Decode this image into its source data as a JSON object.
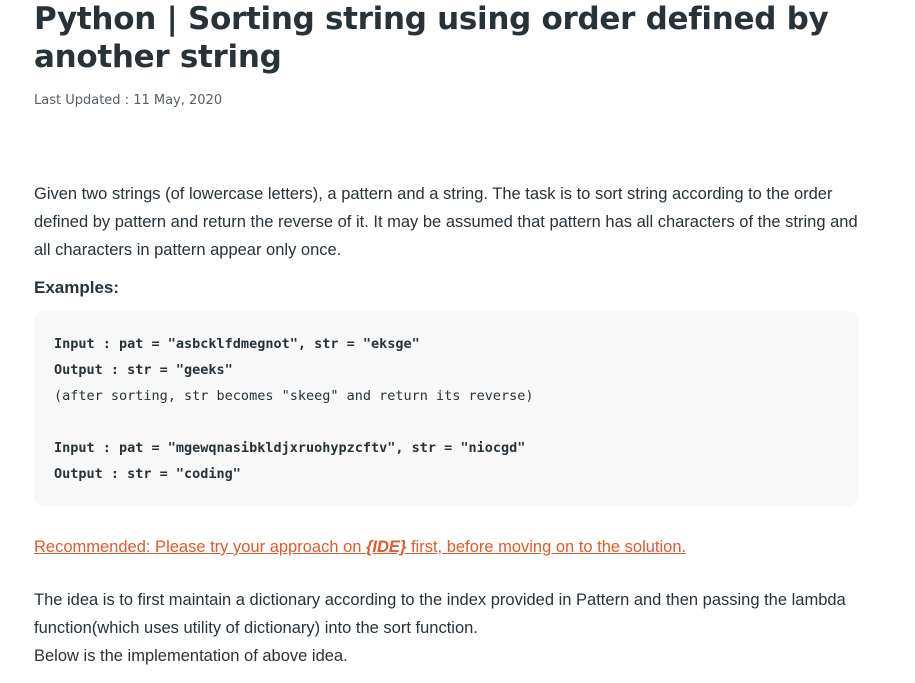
{
  "article": {
    "title": "Python | Sorting string using order defined by another string",
    "last_updated": "Last Updated : 11 May, 2020",
    "intro": "Given two strings (of lowercase letters), a pattern and a string. The task is to sort string according to the order defined by pattern and return the reverse of it. It may be assumed that pattern has all characters of the string and all characters in pattern appear only once.",
    "examples_heading": "Examples:",
    "code_lines": [
      "Input : pat = \"asbcklfdmegnot\", str = \"eksge\"",
      "Output : str = \"geeks\"",
      "(after sorting, str becomes \"skeeg\" and return its reverse)",
      "Input : pat = \"mgewqnasibkldjxruohypzcftv\", str = \"niocgd\"",
      "Output : str = \"coding\""
    ],
    "recommend_prefix": "Recommended: Please try your approach on ",
    "recommend_ide": "{IDE}",
    "recommend_suffix": " first, before moving on to the solution.",
    "idea_line1": "The idea is to first maintain a dictionary according to the index provided in Pattern and then passing the lambda function(which uses utility of dictionary) into the sort function.",
    "idea_line2": "Below is the implementation of above idea."
  }
}
